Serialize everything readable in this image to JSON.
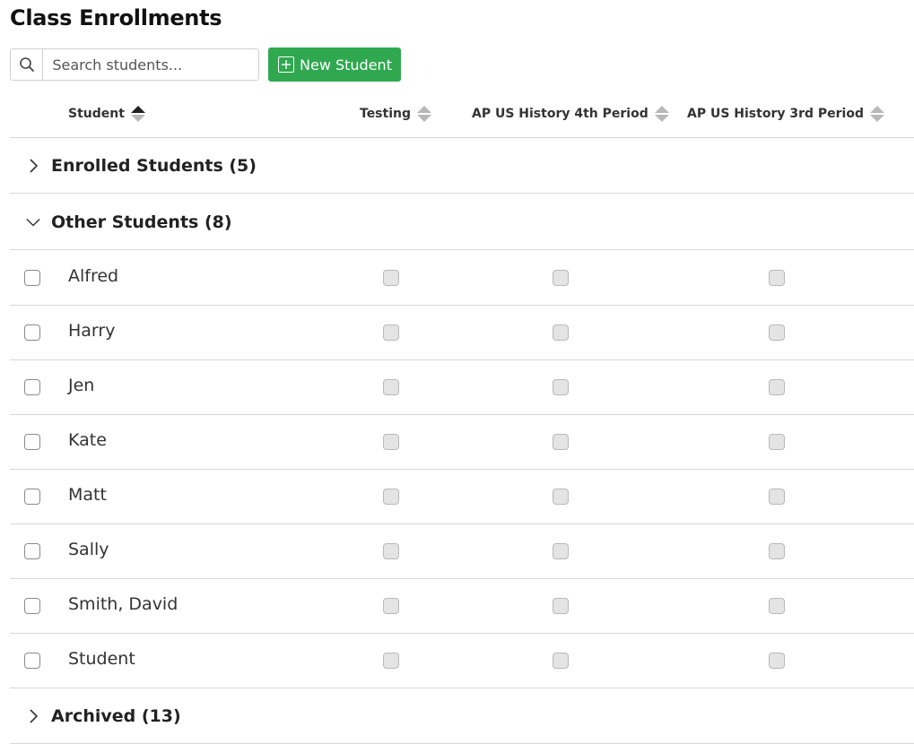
{
  "page": {
    "title": "Class Enrollments"
  },
  "toolbar": {
    "search_placeholder": "Search students...",
    "search_value": "",
    "new_student_label": "New Student",
    "accent_color": "#2fa84f"
  },
  "columns": [
    {
      "label": "Student",
      "sort": "ascending"
    },
    {
      "label": "Testing",
      "sort": "none"
    },
    {
      "label": "AP US History 4th Period",
      "sort": "none"
    },
    {
      "label": "AP US History 3rd Period",
      "sort": "none"
    }
  ],
  "groups": {
    "enrolled": {
      "label": "Enrolled Students (5)",
      "expanded": false
    },
    "other": {
      "label": "Other Students (8)",
      "expanded": true
    },
    "archived": {
      "label": "Archived (13)",
      "expanded": false
    }
  },
  "students": [
    {
      "name": "Alfred",
      "selected": false,
      "testing": false,
      "ap4": false,
      "ap3": false
    },
    {
      "name": "Harry",
      "selected": false,
      "testing": false,
      "ap4": false,
      "ap3": false
    },
    {
      "name": "Jen",
      "selected": false,
      "testing": false,
      "ap4": false,
      "ap3": false
    },
    {
      "name": "Kate",
      "selected": false,
      "testing": false,
      "ap4": false,
      "ap3": false
    },
    {
      "name": "Matt",
      "selected": false,
      "testing": false,
      "ap4": false,
      "ap3": false
    },
    {
      "name": "Sally",
      "selected": false,
      "testing": false,
      "ap4": false,
      "ap3": false
    },
    {
      "name": "Smith, David",
      "selected": false,
      "testing": false,
      "ap4": false,
      "ap3": false
    },
    {
      "name": "Student",
      "selected": false,
      "testing": false,
      "ap4": false,
      "ap3": false
    }
  ]
}
